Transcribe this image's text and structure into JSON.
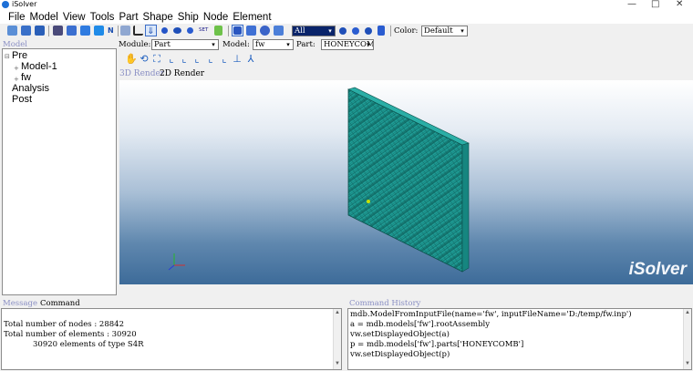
{
  "window": {
    "title": "iSolver",
    "minimize": "—",
    "maximize": "□",
    "close": "✕"
  },
  "menu": [
    "File",
    "Model",
    "View",
    "Tools",
    "Part",
    "Shape",
    "Ship",
    "Node",
    "Element"
  ],
  "toolbar": {
    "filter_value": "All",
    "color_label": "Color:",
    "color_value": "Default",
    "set_label": "SET",
    "n_label": "N"
  },
  "context": {
    "module_label": "Module:",
    "module_value": "Part",
    "model_label": "Model:",
    "model_value": "fw",
    "part_label": "Part:",
    "part_value": "HONEYCOMB"
  },
  "tree": {
    "header": "Model",
    "items": [
      {
        "label": "Pre",
        "expander": "⊟"
      },
      {
        "label": "Model-1",
        "expander": "+"
      },
      {
        "label": "fw",
        "expander": "+"
      },
      {
        "label": "Analysis",
        "expander": ""
      },
      {
        "label": "Post",
        "expander": ""
      }
    ]
  },
  "render_tabs": {
    "tab_3d": "3D Render",
    "tab_2d": "2D Render"
  },
  "viewport": {
    "brand": "iSolver"
  },
  "message_panel": {
    "tab_message": "Message",
    "tab_command": "Command",
    "lines": [
      "Total number of nodes : 28842",
      "Total number of elements : 30920",
      "30920 elements of type S4R"
    ]
  },
  "history_panel": {
    "title": "Command History",
    "lines": [
      "mdb.ModelFromInputFile(name='fw', inputFileName='D:/temp/fw.inp')",
      "a = mdb.models['fw'].rootAssembly",
      "vw.setDisplayedObject(a)",
      "p = mdb.models['fw'].parts['HONEYCOMB']",
      "vw.setDisplayedObject(p)"
    ]
  },
  "colors": {
    "mesh": "#1f9e97",
    "mesh_dark": "#0b4f4b",
    "accent": "#3c6ec8",
    "viewport_bottom": "#3d6b99"
  }
}
